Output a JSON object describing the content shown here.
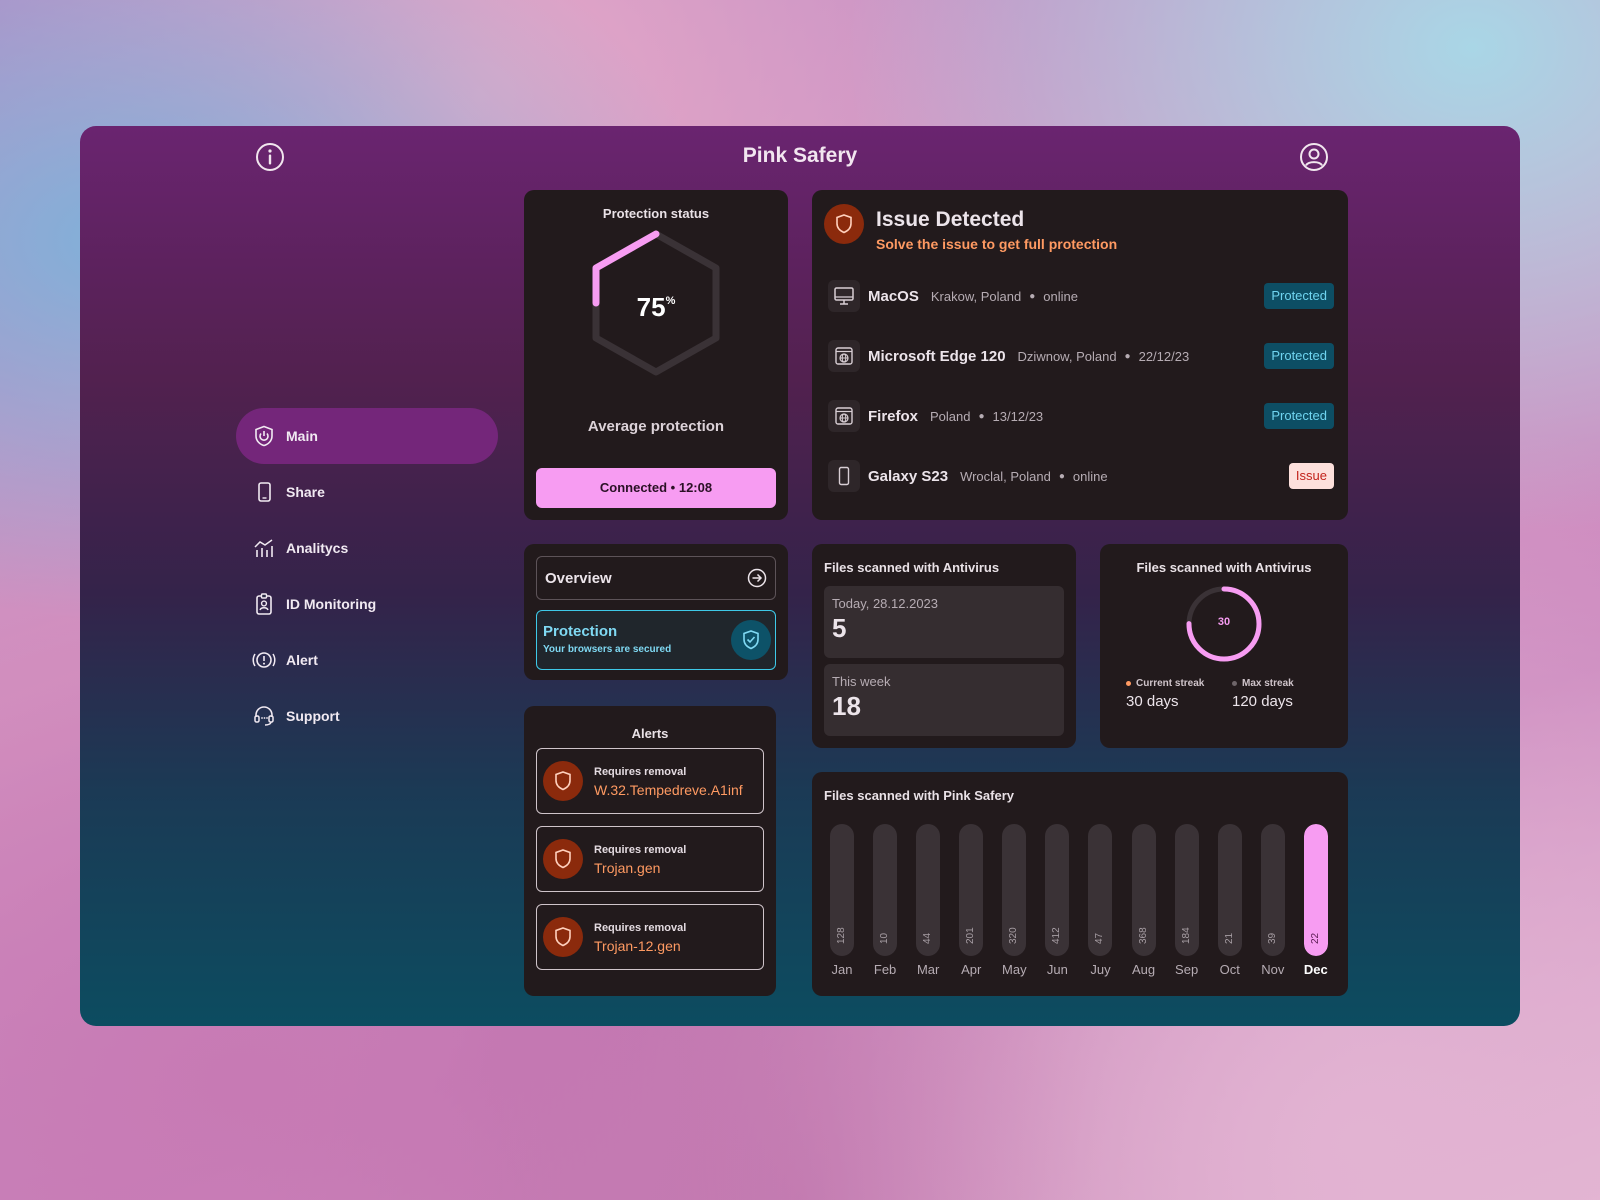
{
  "app": {
    "title": "Pink Safery"
  },
  "sidebar": {
    "items": [
      {
        "label": "Main",
        "icon": "power-shield-icon",
        "active": true
      },
      {
        "label": "Share",
        "icon": "phone-icon"
      },
      {
        "label": "Analitycs",
        "icon": "analytics-icon"
      },
      {
        "label": "ID Monitoring",
        "icon": "id-badge-icon"
      },
      {
        "label": "Alert",
        "icon": "alert-icon"
      },
      {
        "label": "Support",
        "icon": "headset-icon"
      }
    ]
  },
  "protection": {
    "title": "Protection status",
    "percent": "75",
    "percent_unit": "%",
    "percent_value": 0.75,
    "label": "Average protection",
    "connected": "Connected • 12:08"
  },
  "issue": {
    "title": "Issue Detected",
    "subtitle": "Solve the issue to get full protection",
    "devices": [
      {
        "name": "MacOS",
        "location": "Krakow, Poland",
        "status": "online",
        "badge": "Protected",
        "icon": "monitor-icon"
      },
      {
        "name": "Microsoft Edge 120",
        "location": "Dziwnow, Poland",
        "status": "22/12/23",
        "badge": "Protected",
        "icon": "browser-icon"
      },
      {
        "name": "Firefox",
        "location": "Poland",
        "status": "13/12/23",
        "badge": "Protected",
        "icon": "browser-icon"
      },
      {
        "name": "Galaxy S23",
        "location": "Wroclal, Poland",
        "status": "online",
        "badge": "Issue",
        "icon": "phone-icon"
      }
    ]
  },
  "overview": {
    "overview_label": "Overview",
    "protection_label": "Protection",
    "protection_sub": "Your browsers are secured"
  },
  "alerts": {
    "title": "Alerts",
    "items": [
      {
        "label": "Requires removal",
        "name": "W.32.Tempedreve.A1inf"
      },
      {
        "label": "Requires removal",
        "name": "Trojan.gen"
      },
      {
        "label": "Requires removal",
        "name": "Trojan-12.gen"
      }
    ]
  },
  "files_antivirus": {
    "title": "Files scanned with Antivirus",
    "today_label": "Today, 28.12.2023",
    "today_value": "5",
    "week_label": "This week",
    "week_value": "18"
  },
  "streak": {
    "title": "Files scanned with Antivirus",
    "ring_value": "30",
    "current_label": "Current streak",
    "current_value": "30 days",
    "max_label": "Max streak",
    "max_value": "120 days"
  },
  "monthly": {
    "title": "Files scanned with Pink Safery"
  },
  "chart_data": {
    "type": "bar",
    "title": "Files scanned with Pink Safery",
    "categories": [
      "Jan",
      "Feb",
      "Mar",
      "Apr",
      "May",
      "Jun",
      "Juy",
      "Aug",
      "Sep",
      "Oct",
      "Nov",
      "Dec"
    ],
    "values": [
      128,
      10,
      44,
      201,
      320,
      412,
      47,
      368,
      184,
      21,
      39,
      22
    ],
    "highlight_index": 11
  },
  "colors": {
    "accent": "#f79cf2",
    "issue": "#ff9a62",
    "protected_bg": "#0d4e64",
    "protected_text": "#6fd4f0",
    "card": "#221a1c"
  }
}
